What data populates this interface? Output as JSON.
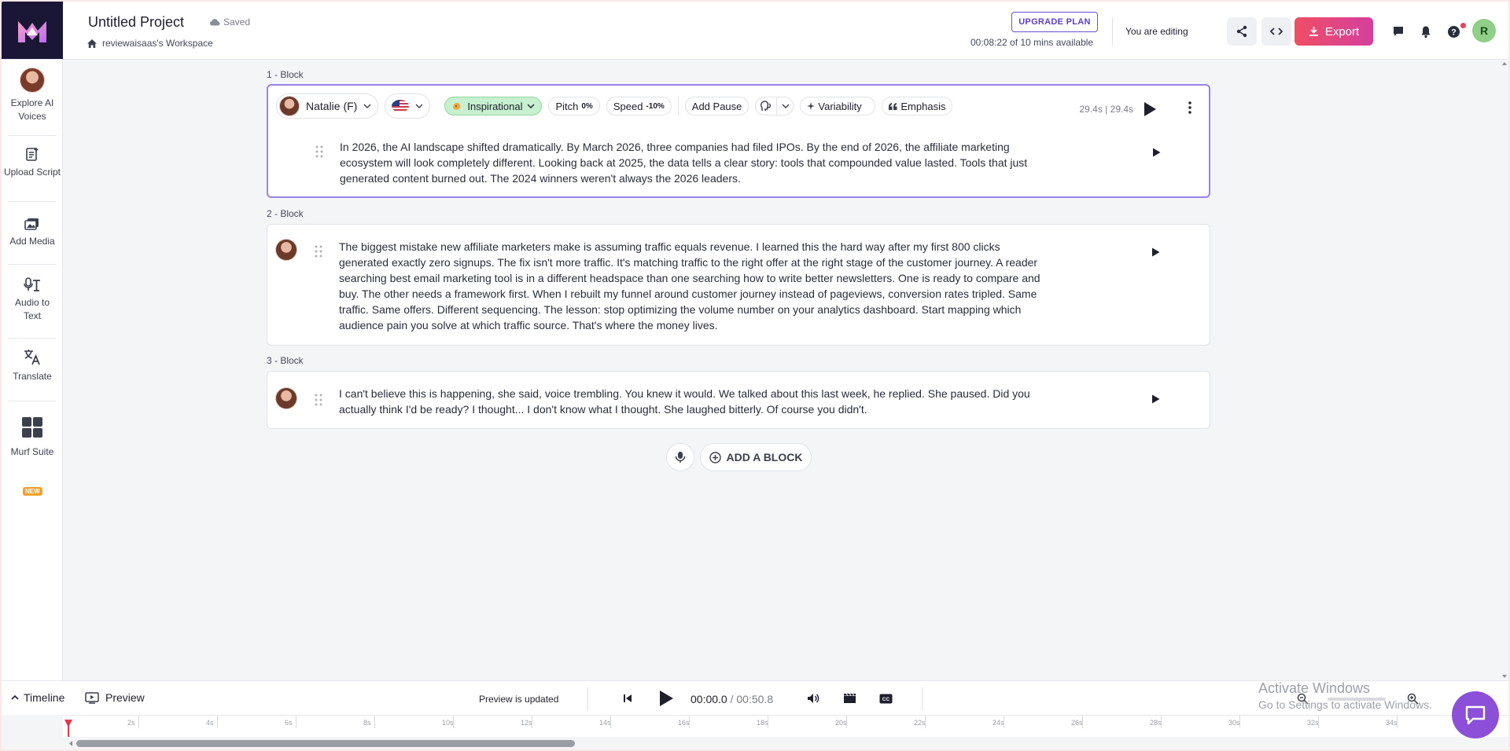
{
  "header": {
    "project_title": "Untitled Project",
    "saved_status": "Saved",
    "workspace": "reviewaisaas's Workspace",
    "upgrade_label": "UPGRADE PLAN",
    "minutes_available": "00:08:22 of 10 mins available",
    "editing_status": "You are editing",
    "export_label": "Export",
    "user_initial": "R"
  },
  "sidebar": {
    "items": [
      {
        "label": "Explore AI Voices",
        "icon": "voice-avatar-icon"
      },
      {
        "label": "Upload Script",
        "icon": "upload-script-icon"
      },
      {
        "label": "Add Media",
        "icon": "media-icon"
      },
      {
        "label": "Audio to Text",
        "icon": "audio-to-text-icon"
      },
      {
        "label": "Translate",
        "icon": "translate-icon"
      },
      {
        "label": "Murf Suite",
        "icon": "suite-icon"
      }
    ],
    "new_badge": "NEW"
  },
  "blocks": [
    {
      "label": "1 -  Block",
      "voice": "Natalie (F)",
      "style": "Inspirational",
      "pitch_label": "Pitch",
      "pitch_value": "0%",
      "speed_label": "Speed",
      "speed_value": "-10%",
      "add_pause": "Add Pause",
      "variability": "Variability",
      "emphasis": "Emphasis",
      "duration": "29.4s | 29.4s",
      "text": "In 2026, the AI landscape shifted dramatically. By March 2026, three companies had filed IPOs. By the end of 2026, the affiliate marketing ecosystem will look completely different. Looking back at 2025, the data tells a clear story: tools that compounded value lasted. Tools that just generated content burned out. The 2024 winners weren't always the 2026 leaders."
    },
    {
      "label": "2 -  Block",
      "text": "The biggest mistake new affiliate marketers make is assuming traffic equals revenue. I learned this the hard way after my first 800 clicks generated exactly zero signups. The fix isn't more traffic. It's matching traffic to the right offer at the right stage of the customer journey. A reader searching best email marketing tool is in a different headspace than one searching how to write better newsletters. One is ready to compare and buy. The other needs a framework first. When I rebuilt my funnel around customer journey instead of pageviews, conversion rates tripled. Same traffic. Same offers. Different sequencing. The lesson: stop optimizing the volume number on your analytics dashboard. Start mapping which audience pain you solve at which traffic source. That's where the money lives."
    },
    {
      "label": "3 -  Block",
      "text": "I can't believe this is happening, she said, voice trembling. You knew it would. We talked about this last week, he replied. She paused. Did you actually think I'd be ready? I thought... I don't know what I thought. She laughed bitterly. Of course you didn't."
    }
  ],
  "add_block_label": "ADD A BLOCK",
  "bottom": {
    "timeline_label": "Timeline",
    "preview_label": "Preview",
    "preview_status": "Preview is updated",
    "current_time": "00:00.0",
    "separator": " / ",
    "total_time": "00:50.8"
  },
  "ruler_ticks": [
    "2s",
    "4s",
    "6s",
    "8s",
    "10s",
    "12s",
    "14s",
    "16s",
    "18s",
    "20s",
    "22s",
    "24s",
    "26s",
    "28s",
    "30s",
    "32s",
    "34s"
  ],
  "watermark": {
    "line1": "Activate Windows",
    "line2": "Go to Settings to activate Windows."
  },
  "colors": {
    "accent": "#9b82e6",
    "export_start": "#f04e64",
    "export_end": "#d43f9e",
    "playhead": "#e8384f",
    "emotion_bg": "#c6f0cf"
  }
}
